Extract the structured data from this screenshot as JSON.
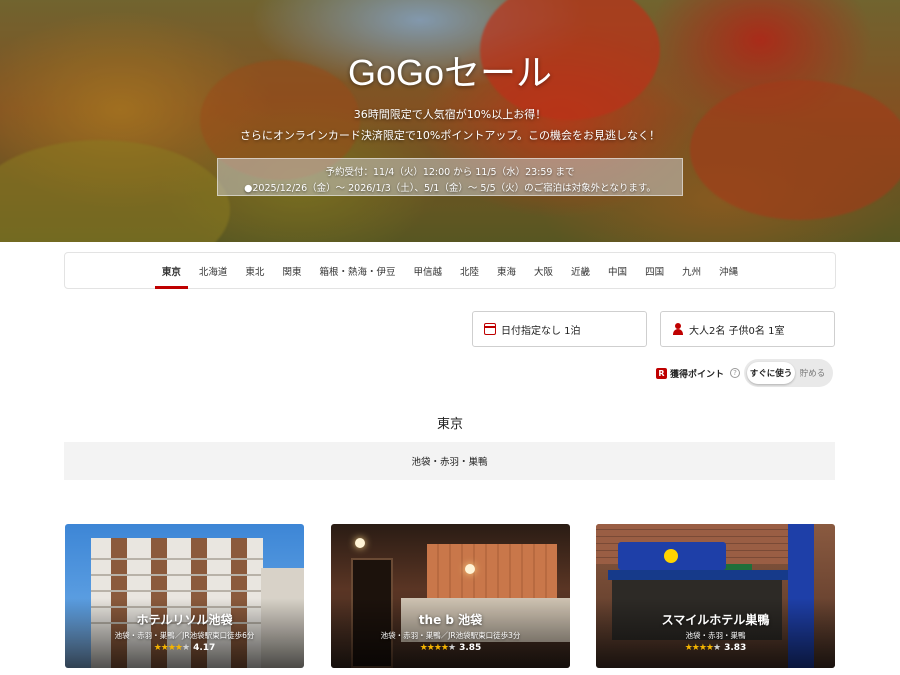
{
  "hero": {
    "title": "GoGoセール",
    "subtitle_line1": "36時間限定で人気宿が10%以上お得！",
    "subtitle_line2": "さらにオンラインカード決済限定で10%ポイントアップ。この機会をお見逃しなく！",
    "notice_line1": "予約受付：11/4（火）12:00 から 11/5（水）23:59 まで",
    "notice_line2": "●2025/12/26（金）～ 2026/1/3（土）、5/1（金）～ 5/5（火）のご宿泊は対象外となります。"
  },
  "region_tabs": [
    {
      "label": "東京",
      "active": true
    },
    {
      "label": "北海道",
      "active": false
    },
    {
      "label": "東北",
      "active": false
    },
    {
      "label": "関東",
      "active": false
    },
    {
      "label": "箱根・熱海・伊豆",
      "active": false
    },
    {
      "label": "甲信越",
      "active": false
    },
    {
      "label": "北陸",
      "active": false
    },
    {
      "label": "東海",
      "active": false
    },
    {
      "label": "大阪",
      "active": false
    },
    {
      "label": "近畿",
      "active": false
    },
    {
      "label": "中国",
      "active": false
    },
    {
      "label": "四国",
      "active": false
    },
    {
      "label": "九州",
      "active": false
    },
    {
      "label": "沖縄",
      "active": false
    }
  ],
  "search": {
    "date_label": "日付指定なし 1泊",
    "guests_label": "大人2名 子供0名 1室"
  },
  "points": {
    "label": "獲得ポイント",
    "option_use": "すぐに使う",
    "option_save": "貯める",
    "selected": "すぐに使う"
  },
  "section": {
    "title": "東京",
    "area": "池袋・赤羽・巣鴨"
  },
  "hotels": [
    {
      "name": "ホテルリソル池袋",
      "location": "池袋・赤羽・巣鴨／JR池袋駅東口徒歩6分",
      "stars": 4,
      "rating": "4.17"
    },
    {
      "name": "the b 池袋",
      "location": "池袋・赤羽・巣鴨／JR池袋駅東口徒歩3分",
      "stars": 4,
      "rating": "3.85"
    },
    {
      "name": "スマイルホテル巣鴨",
      "location": "池袋・赤羽・巣鴨",
      "stars": 4,
      "rating": "3.83"
    }
  ],
  "colors": {
    "accent": "#bf0000",
    "star": "#f5b400",
    "sign_blue": "#1e3fa8"
  }
}
